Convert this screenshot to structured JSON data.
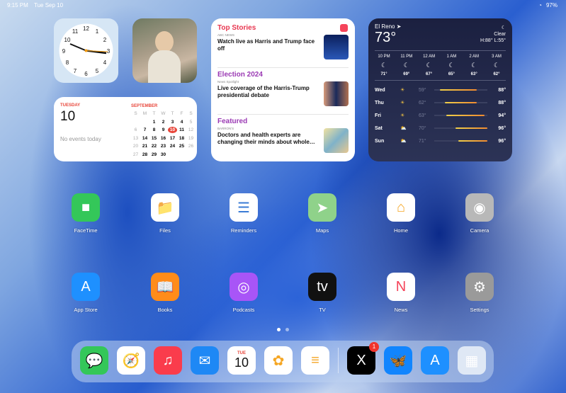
{
  "status": {
    "time": "9:15 PM",
    "date": "Tue Sep 10",
    "battery": "97%"
  },
  "calendar": {
    "weekday": "TUESDAY",
    "day": "10",
    "no_events": "No events today",
    "month": "SEPTEMBER",
    "headers": [
      "S",
      "M",
      "T",
      "W",
      "T",
      "F",
      "S"
    ],
    "days": [
      "",
      "",
      "1",
      "2",
      "3",
      "4",
      "5",
      "6",
      "7",
      "8",
      "9",
      "10",
      "11",
      "12",
      "13",
      "14",
      "15",
      "16",
      "17",
      "18",
      "19",
      "20",
      "21",
      "22",
      "23",
      "24",
      "25",
      "26",
      "27",
      "28",
      "29",
      "30"
    ]
  },
  "news": {
    "sections": [
      {
        "heading": "Top Stories",
        "source": "ABC NEWS",
        "title": "Watch live as Harris and Trump face off",
        "color": "#e8364f"
      },
      {
        "heading": "Election 2024",
        "source": "News Spotlight",
        "title": "Live coverage of the Harris-Trump presidential debate",
        "color": "#9b3ab4"
      },
      {
        "heading": "Featured",
        "source": "BARRON'S",
        "title": "Doctors and health experts are changing their minds about whole…",
        "color": "#9b3ab4"
      }
    ]
  },
  "weather": {
    "location": "El Reno",
    "temp": "73°",
    "condition": "Clear",
    "hilo": "H:88° L:55°",
    "hourly": [
      {
        "t": "10 PM",
        "v": "71°"
      },
      {
        "t": "11 PM",
        "v": "69°"
      },
      {
        "t": "12 AM",
        "v": "67°"
      },
      {
        "t": "1 AM",
        "v": "65°"
      },
      {
        "t": "2 AM",
        "v": "63°"
      },
      {
        "t": "3 AM",
        "v": "62°"
      }
    ],
    "daily": [
      {
        "d": "Wed",
        "lo": "59°",
        "hi": "88°",
        "icon": "sun",
        "a": 0.1,
        "b": 0.8
      },
      {
        "d": "Thu",
        "lo": "62°",
        "hi": "88°",
        "icon": "sun",
        "a": 0.2,
        "b": 0.8
      },
      {
        "d": "Fri",
        "lo": "63°",
        "hi": "94°",
        "icon": "sun",
        "a": 0.22,
        "b": 0.95
      },
      {
        "d": "Sat",
        "lo": "70°",
        "hi": "96°",
        "icon": "partly-cloudy",
        "a": 0.4,
        "b": 1.0
      },
      {
        "d": "Sun",
        "lo": "71°",
        "hi": "96°",
        "icon": "partly-cloudy",
        "a": 0.45,
        "b": 1.0
      }
    ]
  },
  "apps": [
    {
      "label": "FaceTime",
      "bg": "#34c759",
      "glyph": "■"
    },
    {
      "label": "Files",
      "bg": "#ffffff",
      "glyph": "📁"
    },
    {
      "label": "Reminders",
      "bg": "#ffffff",
      "glyph": "☰"
    },
    {
      "label": "Maps",
      "bg": "#8fd28a",
      "glyph": "➤"
    },
    {
      "label": "Home",
      "bg": "#ffffff",
      "glyph": "⌂"
    },
    {
      "label": "Camera",
      "bg": "#b8b8b8",
      "glyph": "◉"
    },
    {
      "label": "App Store",
      "bg": "#1e90ff",
      "glyph": "A"
    },
    {
      "label": "Books",
      "bg": "#ff8c1a",
      "glyph": "📖"
    },
    {
      "label": "Podcasts",
      "bg": "#a855f7",
      "glyph": "◎"
    },
    {
      "label": "TV",
      "bg": "#111111",
      "glyph": "tv"
    },
    {
      "label": "News",
      "bg": "#ffffff",
      "glyph": "N"
    },
    {
      "label": "Settings",
      "bg": "#9a9a9a",
      "glyph": "⚙"
    }
  ],
  "dock": [
    {
      "name": "messages",
      "bg": "#34c759",
      "glyph": "💬"
    },
    {
      "name": "safari",
      "bg": "#ffffff",
      "glyph": "🧭"
    },
    {
      "name": "music",
      "bg": "#fa3c4c",
      "glyph": "♫"
    },
    {
      "name": "mail",
      "bg": "#1e88f5",
      "glyph": "✉"
    },
    {
      "name": "calendar",
      "bg": "#ffffff",
      "glyph": "10",
      "sub": "TUE"
    },
    {
      "name": "photos",
      "bg": "#ffffff",
      "glyph": "✿"
    },
    {
      "name": "notes",
      "bg": "#ffffff",
      "glyph": "≡"
    },
    {
      "name": "x",
      "bg": "#000000",
      "glyph": "X",
      "badge": "1"
    },
    {
      "name": "bluesky",
      "bg": "#1185fe",
      "glyph": "🦋"
    },
    {
      "name": "app-store",
      "bg": "#1e90ff",
      "glyph": "A"
    },
    {
      "name": "app-library",
      "bg": "#dfe8f5",
      "glyph": "▦"
    }
  ]
}
